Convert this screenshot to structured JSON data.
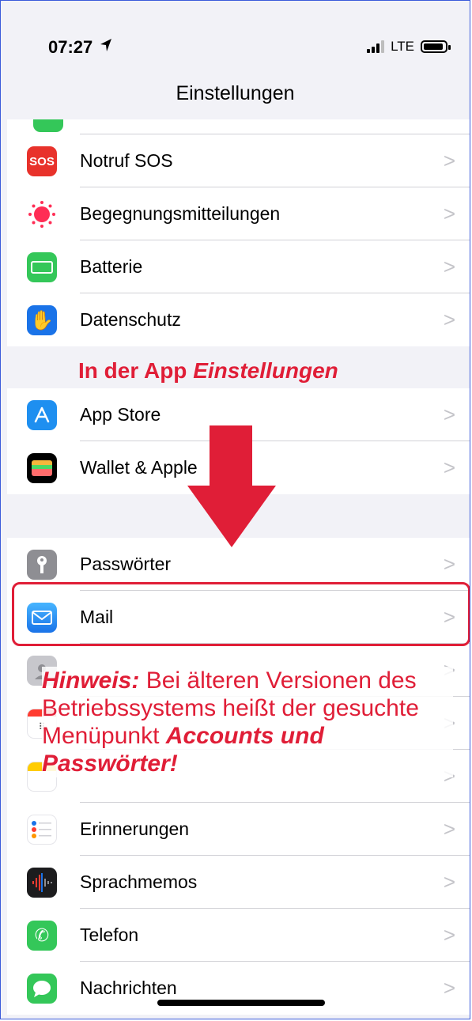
{
  "status_bar": {
    "time": "07:27",
    "network": "LTE"
  },
  "nav": {
    "title": "Einstellungen"
  },
  "group1": [
    {
      "label": "Notruf SOS",
      "icon": "sos-icon",
      "color": "#e8322b"
    },
    {
      "label": "Begegnungsmitteilungen",
      "icon": "exposure-icon",
      "color": "#ffffff"
    },
    {
      "label": "Batterie",
      "icon": "battery-icon",
      "color": "#34c759"
    },
    {
      "label": "Datenschutz",
      "icon": "privacy-hand-icon",
      "color": "#1a73e8"
    }
  ],
  "group2": [
    {
      "label": "App Store",
      "icon": "app-store-icon",
      "color": "#1e8ff0"
    },
    {
      "label": "Wallet & Apple",
      "icon": "wallet-icon",
      "color": "#000000"
    }
  ],
  "group3": [
    {
      "label": "Passwörter",
      "icon": "key-icon",
      "color": "#8e8e93"
    },
    {
      "label": "Mail",
      "icon": "mail-icon",
      "color": "#2f8cf7"
    },
    {
      "label": "",
      "icon": "contacts-icon",
      "color": "#b5b5ba"
    },
    {
      "label": "",
      "icon": "calendar-icon",
      "color": "#ffffff"
    },
    {
      "label": "",
      "icon": "notes-icon",
      "color": "#ffffff"
    },
    {
      "label": "Erinnerungen",
      "icon": "reminders-icon",
      "color": "#ffffff"
    },
    {
      "label": "Sprachmemos",
      "icon": "voice-memos-icon",
      "color": "#1c1c1e"
    },
    {
      "label": "Telefon",
      "icon": "phone-icon",
      "color": "#34c759"
    },
    {
      "label": "Nachrichten",
      "icon": "messages-icon",
      "color": "#34c759"
    }
  ],
  "annotation": {
    "caption_prefix": "In der App ",
    "caption_app": "Einstellungen",
    "note_lead": "Hinweis:",
    "note_body": " Bei älteren Versionen des Betriebssystems heißt der gesuchte Menüpunkt ",
    "note_term": "Accounts und Passwörter!",
    "accent_color": "#e01e37"
  },
  "chevron": ">"
}
